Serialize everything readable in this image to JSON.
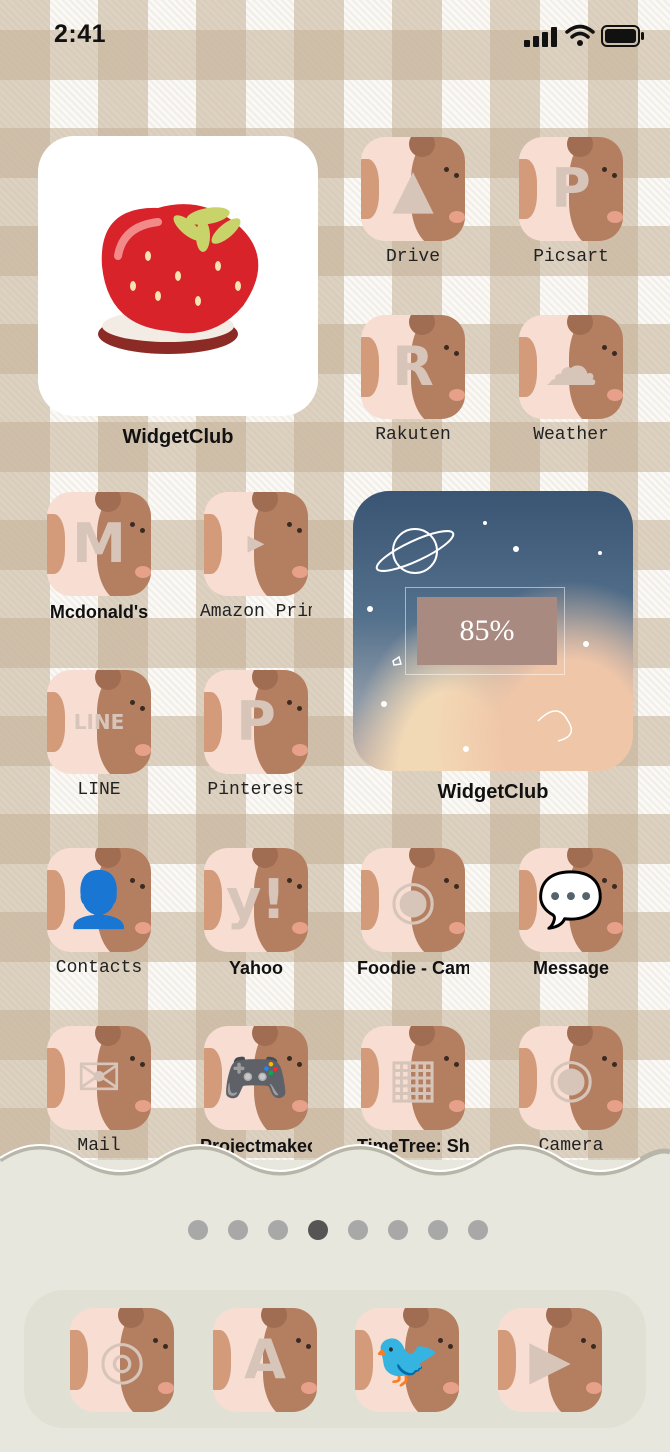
{
  "status_bar": {
    "time": "2:41"
  },
  "widgets": {
    "top_left": {
      "label": "WidgetClub"
    },
    "right": {
      "label": "WidgetClub",
      "battery_text": "85%"
    }
  },
  "apps": {
    "drive": "Drive",
    "picsart": "Picsart",
    "rakuten": "Rakuten",
    "weather": "Weather",
    "mcdonalds": "Mcdonald's",
    "amazon": "Amazon Prime V",
    "line": "LINE",
    "pinterest": "Pinterest",
    "contacts": "Contacts",
    "yahoo": "Yahoo",
    "foodie": "Foodie - Came",
    "message": "Message",
    "mail": "Mail",
    "projectmakeover": "Projectmakeo",
    "timetree": "TimeTree: Sha",
    "camera": "Camera"
  },
  "page_dots": {
    "count": 8,
    "active_index": 3
  },
  "dock": {
    "apps": [
      "instagram",
      "app-store",
      "twitter",
      "youtube"
    ]
  },
  "colors": {
    "bear": "#b47f61",
    "icon_bg": "#f8ddd3",
    "dock_bg": "#e8e7dd",
    "glyph": "#d8c5ba"
  }
}
